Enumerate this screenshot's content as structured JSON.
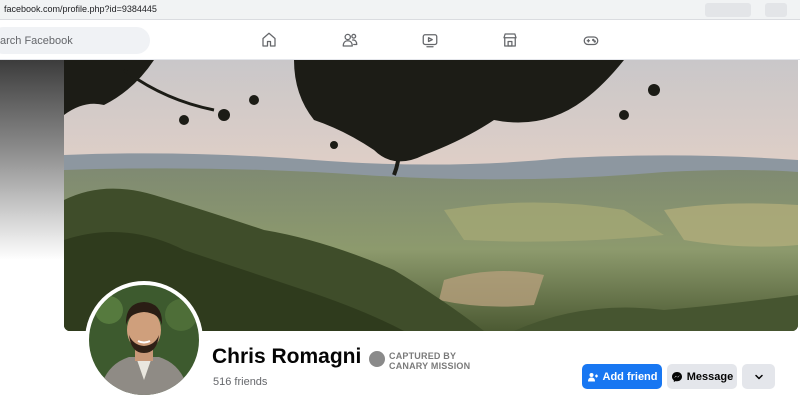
{
  "browser": {
    "url": "facebook.com/profile.php?id=9384445"
  },
  "topnav": {
    "search_placeholder": "arch Facebook",
    "icons": [
      "home-icon",
      "friends-icon",
      "watch-icon",
      "marketplace-icon",
      "gaming-icon"
    ]
  },
  "profile": {
    "name": "Chris Romagni",
    "friends_count": "516 friends",
    "stamp_line1": "CAPTURED BY",
    "stamp_line2": "CANARY MISSION"
  },
  "actions": {
    "add_friend": "Add friend",
    "message": "Message"
  },
  "colors": {
    "accent": "#1877f2",
    "secondary_button": "#e4e6eb",
    "text_primary": "#050505",
    "text_secondary": "#65676b"
  }
}
